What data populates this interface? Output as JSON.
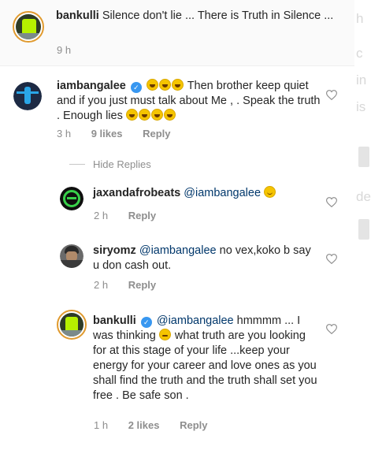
{
  "comments": [
    {
      "username": "bankulli",
      "text": "Silence don't lie ... There is Truth in Silence ...",
      "time": "9 h"
    },
    {
      "username": "iambangalee",
      "verified": true,
      "emoji_prefix": "😅😅😅",
      "text": "Then brother keep quiet  and if you just must talk about Me , . Speak the truth . Enough lies ",
      "emoji_suffix": "😅😅😅😝",
      "time": "3 h",
      "likes": "9 likes",
      "reply": "Reply"
    }
  ],
  "hide_replies": "Hide Replies",
  "replies": [
    {
      "username": "jaxandafrobeats",
      "mention": "@iambangalee",
      "text": "",
      "emoji": "🙂",
      "time": "2 h",
      "reply": "Reply"
    },
    {
      "username": "siryomz",
      "mention": "@iambangalee",
      "text": "no vex,koko b say u don cash out.",
      "time": "2 h",
      "reply": "Reply"
    },
    {
      "username": "bankulli",
      "verified": true,
      "mention": "@iambangalee",
      "text_part1": "hmmmm ... I was thinking ",
      "emoji": "🤔",
      "text_part2": " what truth are you looking for at this stage of your life ...keep your energy for your career and love ones as you shall find the truth and the truth shall set you free . Be safe son .",
      "time": "1 h",
      "likes": "2 likes",
      "reply": "Reply"
    }
  ],
  "icons": {
    "like": "heart-icon",
    "verified": "verified-badge-icon"
  },
  "colors": {
    "username": "#262626",
    "mention": "#00376b",
    "meta": "#8e8e8e",
    "verified": "#3897f0",
    "story_ring": "#e09a2e"
  }
}
